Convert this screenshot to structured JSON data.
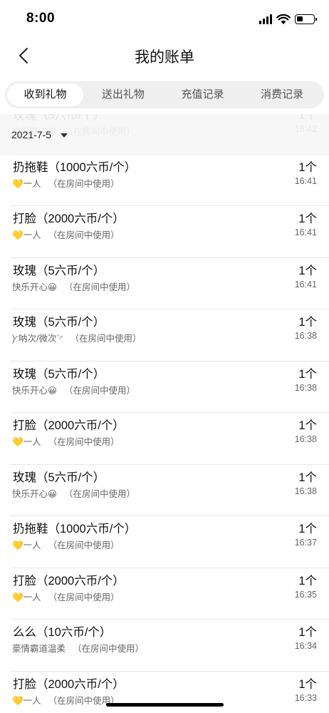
{
  "status_bar": {
    "time": "8:00"
  },
  "header": {
    "title": "我的账单"
  },
  "tabs": [
    {
      "label": "收到礼物",
      "active": true
    },
    {
      "label": "送出礼物",
      "active": false
    },
    {
      "label": "充值记录",
      "active": false
    },
    {
      "label": "消费记录",
      "active": false
    }
  ],
  "date_header": {
    "label": "2021-7-5"
  },
  "rows": [
    {
      "title": "玫瑰（5六币/个）",
      "sub": "快乐开心😀",
      "note": "（在房间中使用）",
      "count": "1个",
      "time": "16:42"
    },
    {
      "title": "扔拖鞋（1000六币/个）",
      "sub": "💛一人",
      "note": "（在房间中使用）",
      "count": "1个",
      "time": "16:41"
    },
    {
      "title": "打脸（2000六币/个）",
      "sub": "💛一人",
      "note": "（在房间中使用）",
      "count": "1个",
      "time": "16:41"
    },
    {
      "title": "玫瑰（5六币/个）",
      "sub": "快乐开心😀",
      "note": "（在房间中使用）",
      "count": "1个",
      "time": "16:41"
    },
    {
      "title": "玫瑰（5六币/个）",
      "sub": ")◜呐次/微次`◜",
      "note": "（在房间中使用）",
      "count": "1个",
      "time": "16:38"
    },
    {
      "title": "玫瑰（5六币/个）",
      "sub": "快乐开心😀",
      "note": "（在房间中使用）",
      "count": "1个",
      "time": "16:38"
    },
    {
      "title": "打脸（2000六币/个）",
      "sub": "💛一人",
      "note": "（在房间中使用）",
      "count": "1个",
      "time": "16:38"
    },
    {
      "title": "玫瑰（5六币/个）",
      "sub": "快乐开心😀",
      "note": "（在房间中使用）",
      "count": "1个",
      "time": "16:38"
    },
    {
      "title": "扔拖鞋（1000六币/个）",
      "sub": "💛一人",
      "note": "（在房间中使用）",
      "count": "1个",
      "time": "16:37"
    },
    {
      "title": "打脸（2000六币/个）",
      "sub": "💛一人",
      "note": "（在房间中使用）",
      "count": "1个",
      "time": "16:35"
    },
    {
      "title": "么么（10六币/个）",
      "sub": "豪情霸道温柔",
      "note": "（在房间中使用）",
      "count": "1个",
      "time": "16:34"
    },
    {
      "title": "打脸（2000六币/个）",
      "sub": "💛一人",
      "note": "（在房间中使用）",
      "count": "1个",
      "time": "16:33"
    }
  ]
}
